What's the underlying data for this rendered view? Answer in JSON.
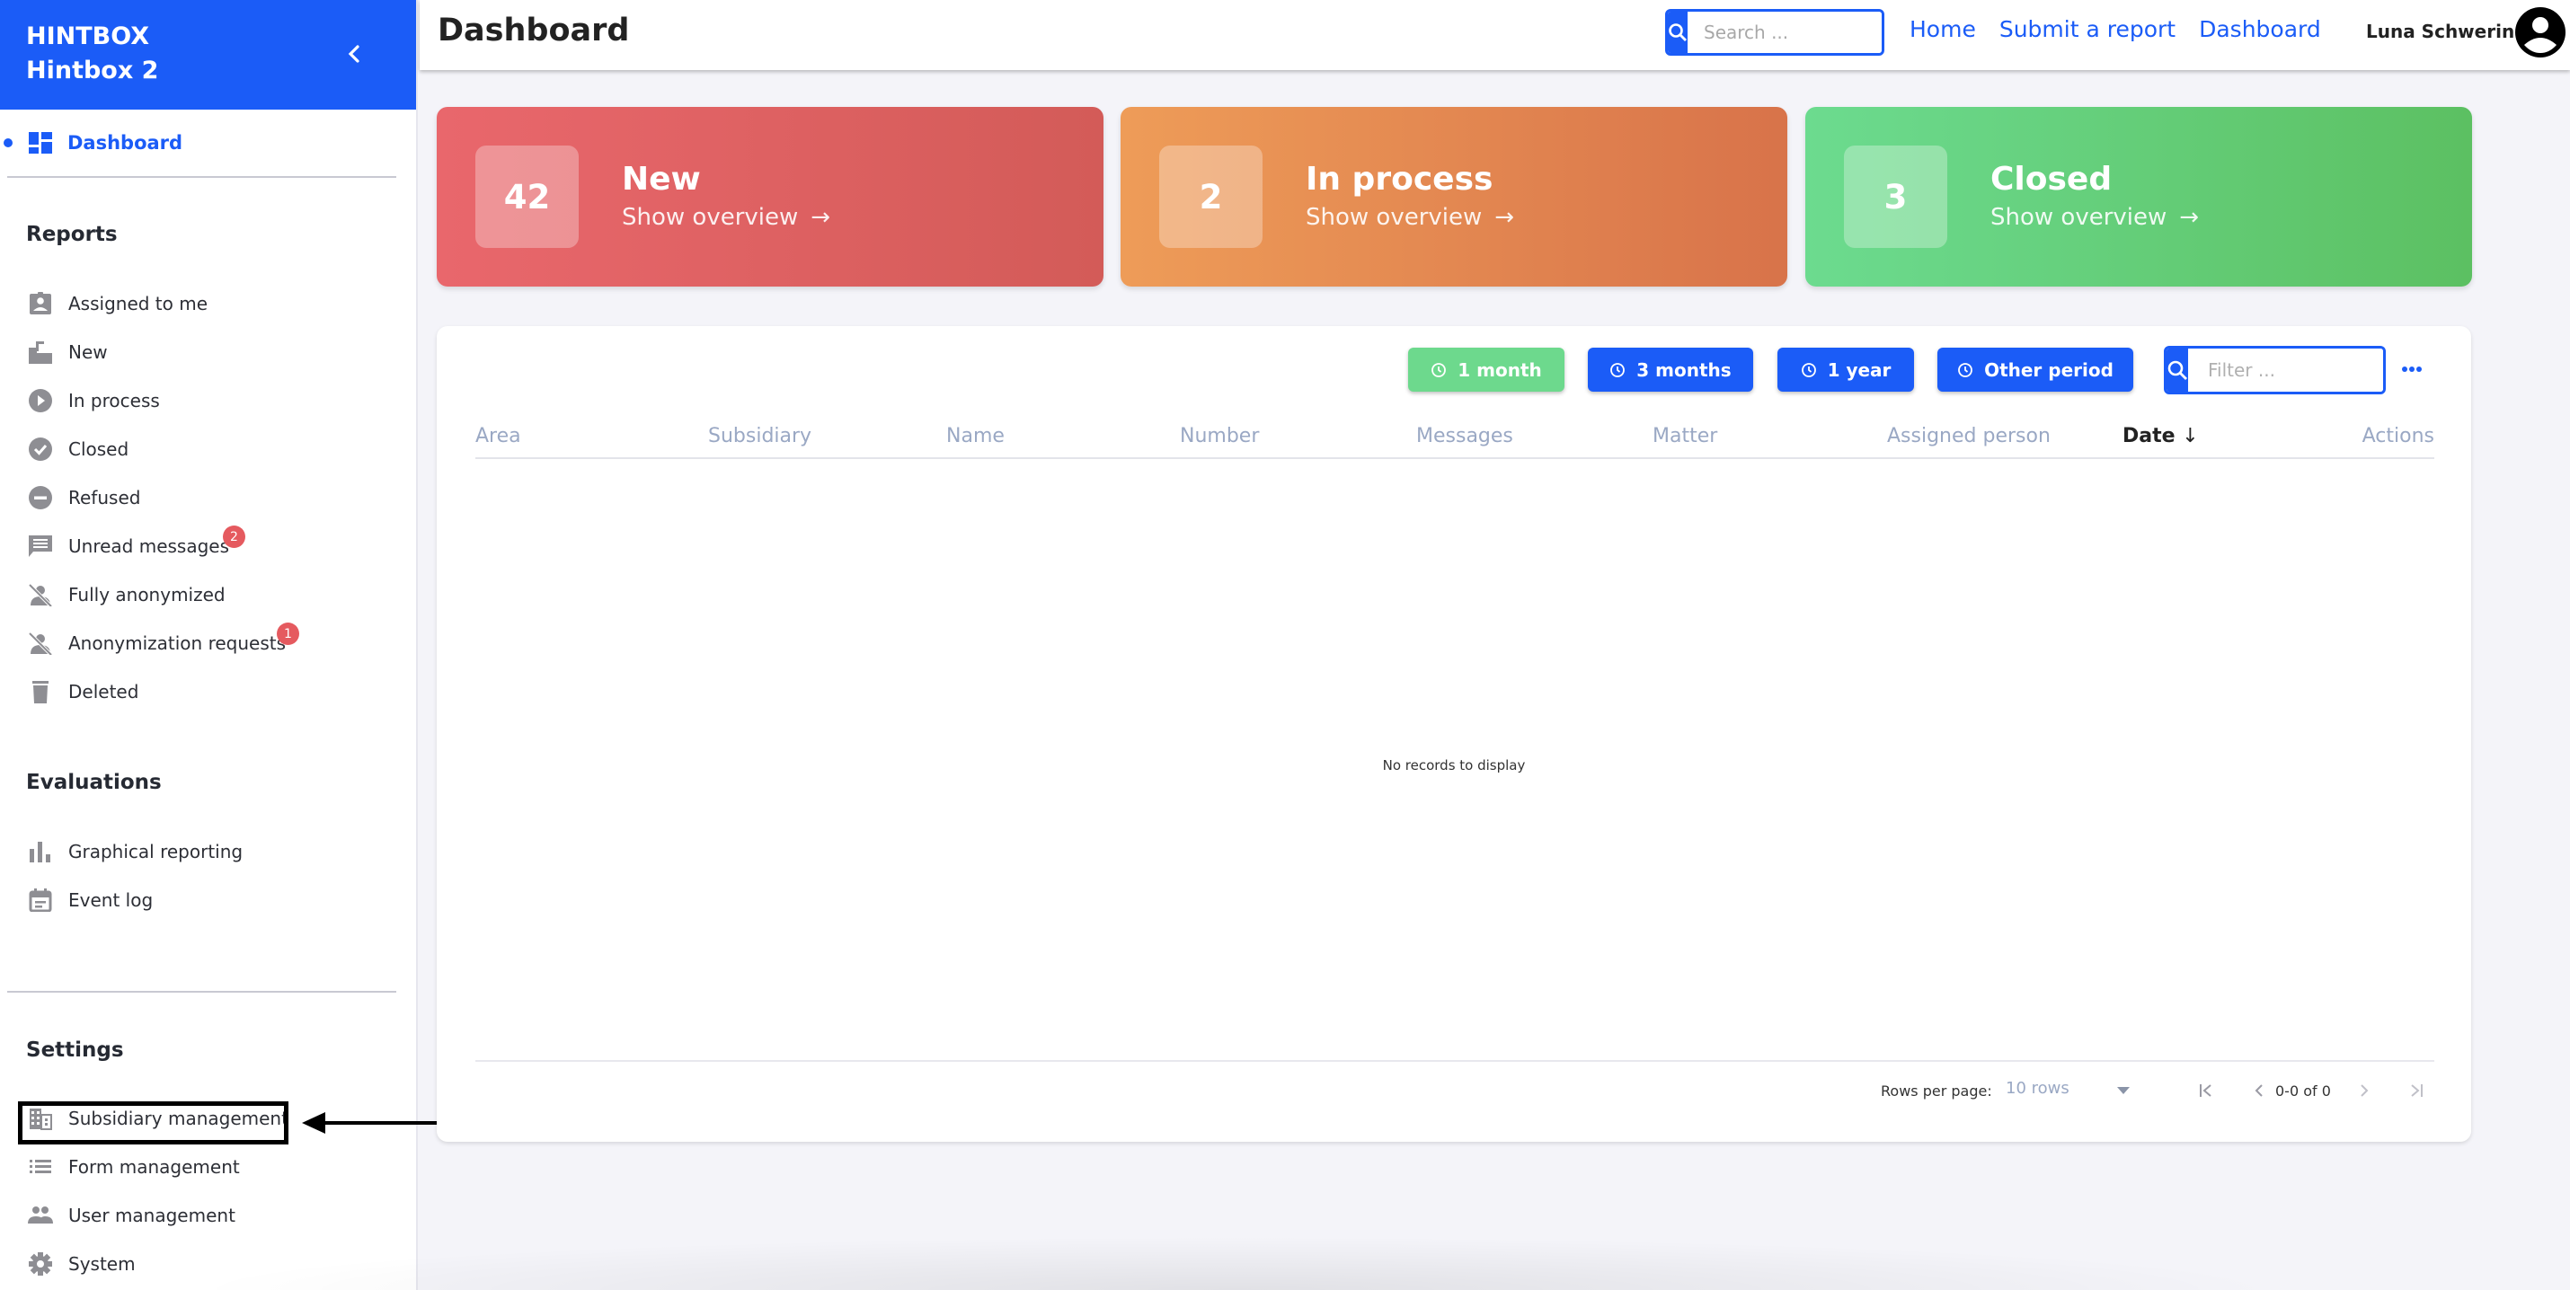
{
  "brand": {
    "line1": "HINTBOX",
    "line2": "Hintbox 2",
    "color": "#1b5cf7"
  },
  "sidebar": {
    "active_item": {
      "label": "Dashboard",
      "icon": "dashboard-icon"
    },
    "sections": {
      "reports": {
        "title": "Reports",
        "items": [
          {
            "label": "Assigned to me",
            "icon": "assignment-ind-icon"
          },
          {
            "label": "New",
            "icon": "new-inbox-icon"
          },
          {
            "label": "In process",
            "icon": "play-circle-icon"
          },
          {
            "label": "Closed",
            "icon": "check-circle-icon"
          },
          {
            "label": "Refused",
            "icon": "do-not-disturb-icon"
          },
          {
            "label": "Unread messages",
            "icon": "message-icon",
            "badge": "2"
          },
          {
            "label": "Fully anonymized",
            "icon": "person-off-icon"
          },
          {
            "label": "Anonymization requests",
            "icon": "person-off-icon",
            "badge": "1"
          },
          {
            "label": "Deleted",
            "icon": "trash-icon"
          }
        ]
      },
      "evaluations": {
        "title": "Evaluations",
        "items": [
          {
            "label": "Graphical reporting",
            "icon": "bar-chart-icon"
          },
          {
            "label": "Event log",
            "icon": "calendar-icon"
          }
        ]
      },
      "settings": {
        "title": "Settings",
        "items": [
          {
            "label": "Subsidiary management",
            "icon": "building-icon",
            "highlighted": true
          },
          {
            "label": "Form management",
            "icon": "list-icon"
          },
          {
            "label": "User management",
            "icon": "people-icon"
          },
          {
            "label": "System",
            "icon": "gear-icon"
          }
        ]
      }
    }
  },
  "header": {
    "title": "Dashboard",
    "search_placeholder": "Search ...",
    "links": [
      "Home",
      "Submit a report",
      "Dashboard"
    ],
    "user_name": "Luna Schwerin"
  },
  "stats": [
    {
      "count": "42",
      "label": "New",
      "link": "Show overview",
      "arrow": "→",
      "color": "#e9676c"
    },
    {
      "count": "2",
      "label": "In process",
      "link": "Show overview",
      "arrow": "→",
      "color": "#ee9c58"
    },
    {
      "count": "3",
      "label": "Closed",
      "link": "Show overview",
      "arrow": "→",
      "color": "#6cdb8f"
    }
  ],
  "table": {
    "periods": [
      {
        "label": "1 month",
        "active": true
      },
      {
        "label": "3 months",
        "active": false
      },
      {
        "label": "1 year",
        "active": false
      },
      {
        "label": "Other period",
        "active": false
      }
    ],
    "filter_placeholder": "Filter ...",
    "columns": [
      "Area",
      "Subsidiary",
      "Name",
      "Number",
      "Messages",
      "Matter",
      "Assigned person",
      "Date",
      "Actions"
    ],
    "sorted_column": "Date",
    "sort_direction": "↓",
    "empty_message": "No records to display",
    "footer": {
      "rows_per_page_label": "Rows per page:",
      "rows_per_page_value": "10 rows",
      "range": "0-0 of 0"
    }
  }
}
